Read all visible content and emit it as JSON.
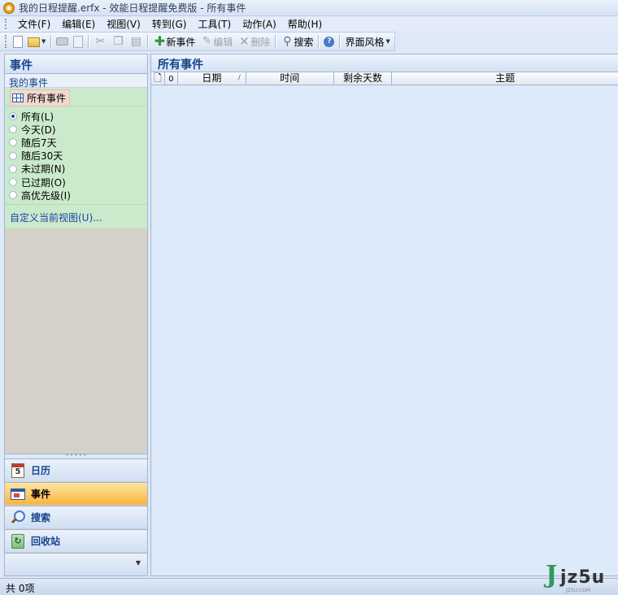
{
  "window": {
    "title": "我的日程提醒.erfx - 效能日程提醒免费版 - 所有事件"
  },
  "menu": [
    {
      "label": "文件(F)"
    },
    {
      "label": "编辑(E)"
    },
    {
      "label": "视图(V)"
    },
    {
      "label": "转到(G)"
    },
    {
      "label": "工具(T)"
    },
    {
      "label": "动作(A)"
    },
    {
      "label": "帮助(H)"
    }
  ],
  "toolbar": {
    "new_event": "新事件",
    "edit": "编辑",
    "delete": "删除",
    "search": "搜索",
    "skin": "界面风格"
  },
  "sidebar": {
    "title": "事件",
    "my_events": "我的事件",
    "all_events": "所有事件",
    "filters": [
      {
        "label": "所有(L)",
        "checked": true
      },
      {
        "label": "今天(D)",
        "checked": false
      },
      {
        "label": "随后7天",
        "checked": false
      },
      {
        "label": "随后30天",
        "checked": false
      },
      {
        "label": "未过期(N)",
        "checked": false
      },
      {
        "label": "已过期(O)",
        "checked": false
      },
      {
        "label": "高优先级(I)",
        "checked": false
      }
    ],
    "customize_link": "自定义当前视图(U)...",
    "nav": [
      {
        "label": "日历",
        "icon": "calendar-icon"
      },
      {
        "label": "事件",
        "icon": "events-icon",
        "active": true
      },
      {
        "label": "搜索",
        "icon": "magnifier-icon"
      },
      {
        "label": "回收站",
        "icon": "recycle-bin-icon"
      }
    ],
    "calendar_day": "5"
  },
  "main": {
    "title": "所有事件",
    "columns": [
      "日期",
      "时间",
      "剩余天数",
      "主题"
    ]
  },
  "status": {
    "text": "共 0项"
  },
  "watermark": {
    "brand_j": "J",
    "brand": "jz5u",
    "sub": "JZ5U.COM"
  },
  "colors": {
    "accent": "#15428b",
    "active_nav": "#f9b43c",
    "filter_panel": "#cbeacb"
  }
}
